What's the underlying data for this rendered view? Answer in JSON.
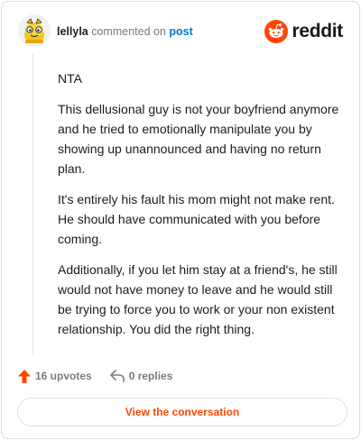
{
  "comment": {
    "username": "lellyla",
    "verb": "commented on",
    "link_text": "post",
    "paragraphs": [
      "NTA",
      "This dellusional guy is not your boyfriend anymore and he tried to emotionally manipulate you by showing up unannounced and having no return plan.",
      "It's entirely his fault his mom might not make rent. He should have communicated with you before coming.",
      "Additionally, if you let him stay at a friend's, he still would not have money to leave and he would still be trying to force you to work or your non existent relationship. You did the right thing."
    ]
  },
  "brand": {
    "logo_text": "reddit",
    "color": "#ff4500"
  },
  "actions": {
    "upvotes": "16 upvotes",
    "replies": "0 replies"
  },
  "cta_label": "View the conversation",
  "icons": [
    "avatar",
    "reddit-snoo-icon",
    "upvote-arrow-icon",
    "reply-arrow-icon"
  ]
}
